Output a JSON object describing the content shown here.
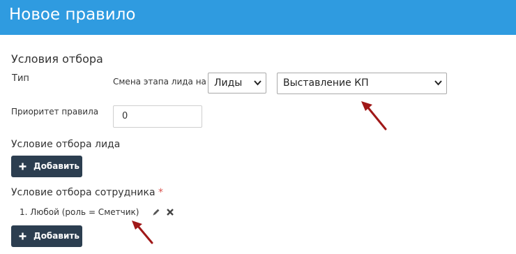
{
  "header": {
    "title": "Новое правило"
  },
  "conditions": {
    "section_title": "Условия отбора",
    "type_label": "Тип",
    "stage_change_label": "Смена этапа лида на",
    "entity_select": {
      "value": "Лиды"
    },
    "stage_select": {
      "value": "Выставление КП"
    },
    "priority_label": "Приоритет правила",
    "priority_value": "0"
  },
  "lead_condition": {
    "title": "Условие отбора лида",
    "add_label": "Добавить"
  },
  "employee_condition": {
    "title": "Условие отбора сотрудника",
    "required_mark": "*",
    "items": [
      {
        "text": "1. Любой (роль = Сметчик)"
      }
    ],
    "add_label": "Добавить"
  },
  "colors": {
    "header": "#2f9be0",
    "button": "#2c3e50",
    "required": "#d9534f",
    "annotation_arrow": "#a01818"
  },
  "icons": [
    "plus-icon",
    "pencil-icon",
    "close-icon",
    "chevron-down-icon",
    "annotation-arrow"
  ]
}
